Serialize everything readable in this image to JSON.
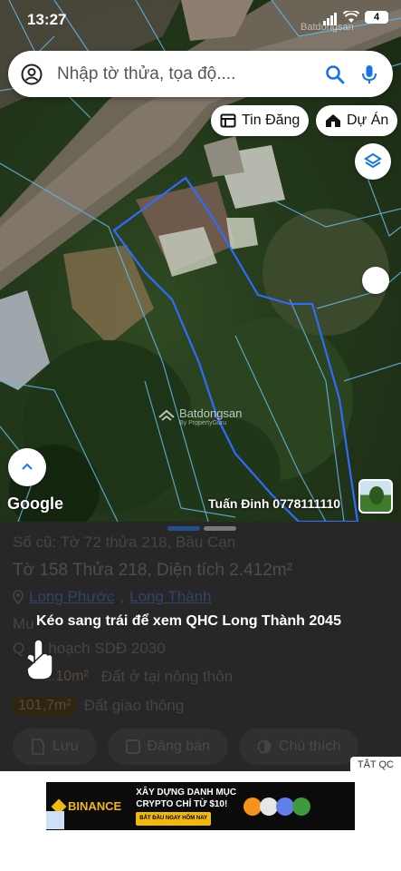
{
  "status_bar": {
    "time": "13:27",
    "battery": "4"
  },
  "search": {
    "placeholder": "Nhập tờ thửa, tọa độ...."
  },
  "chips": {
    "listings": "Tin Đăng",
    "projects": "Dự Án"
  },
  "map": {
    "watermark_top": "Batdongsan",
    "watermark_mid": "Batdongsan",
    "watermark_mid_sub": "By PropertyGuru",
    "google_label": "Google",
    "owner_text": "Tuấn Đinh 0778111110"
  },
  "panel": {
    "old_number": "Số cũ: Tờ 72 thửa 218, Bầu Cạn",
    "sheet": "Tờ 158 Thửa 218, Diện tích 2.412m²",
    "location": {
      "ward": "Long Phước",
      "district": "Long Thành",
      "separator": ", "
    },
    "plan_line_prefix": "Mu",
    "plan_line": "Q",
    "plan_line_rest": "hoạch SDĐ 2030",
    "land_rows": [
      {
        "area": "...10m²",
        "label": "Đất ở tại nông thôn"
      },
      {
        "area": "101,7m²",
        "label": "Đất giao thông"
      }
    ],
    "buttons": [
      "Lưu",
      "Đăng bán",
      "Chú thích"
    ]
  },
  "overlay": {
    "hint": "Kéo sang trái để xem QHC Long Thành 2045"
  },
  "ads": {
    "close_label": "TẮT QC",
    "brand": "BINANCE",
    "headline_1": "XÂY DỰNG DANH MỤC",
    "headline_2": "CRYPTO CHỈ TỪ $10!",
    "cta": "BẮT ĐẦU NGAY HÔM NAY"
  },
  "colors": {
    "accent": "#3a79d6",
    "parcel_outline": "#2f6bff",
    "ad_brand": "#f0b90b"
  }
}
